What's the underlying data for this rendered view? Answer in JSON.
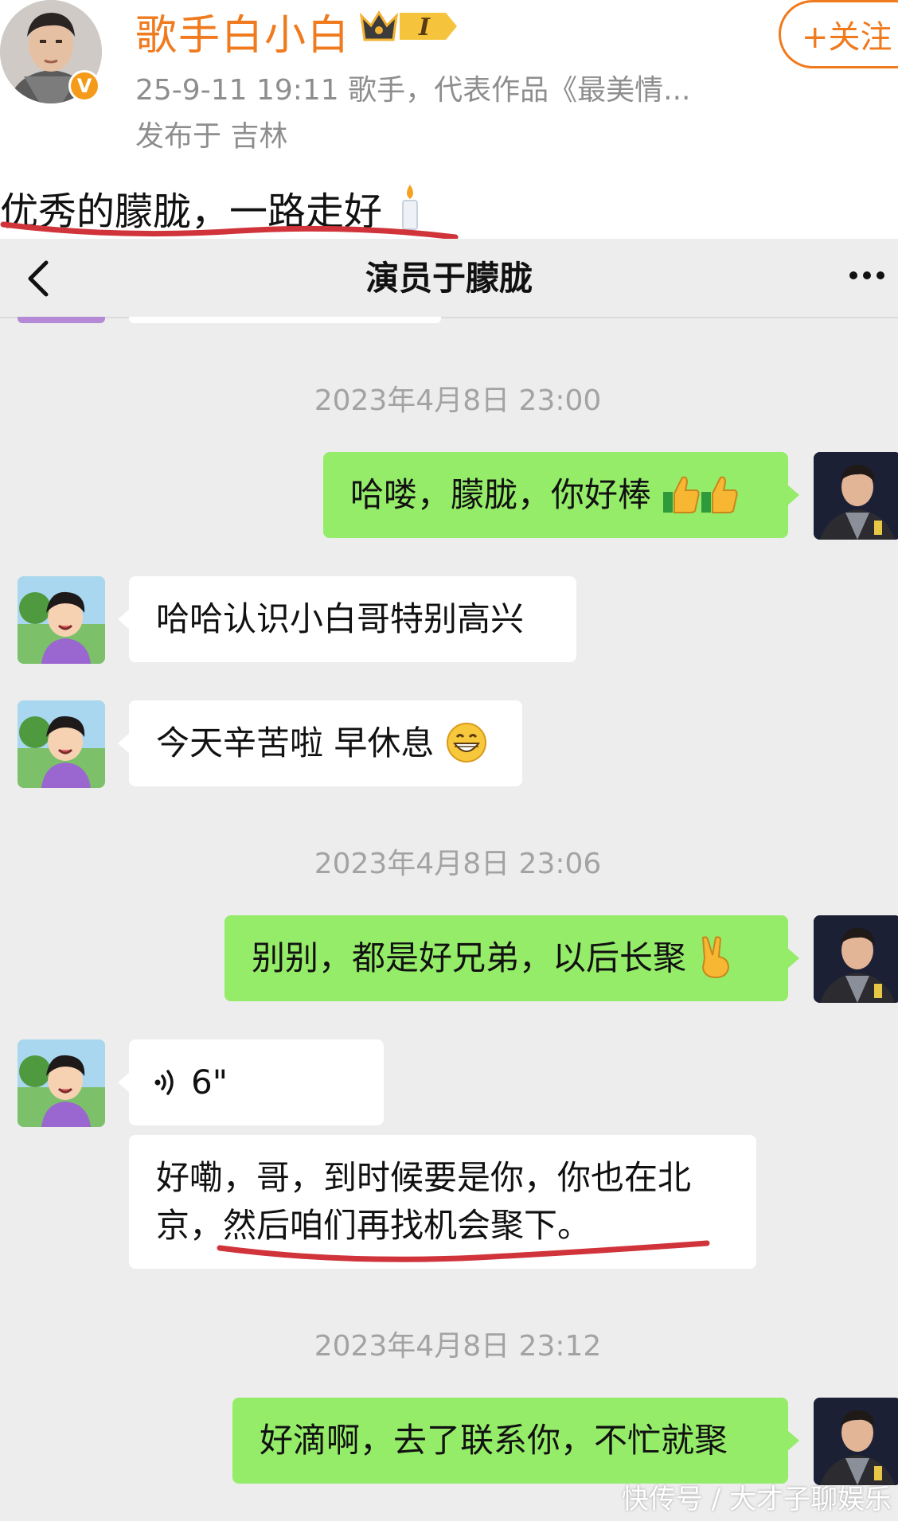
{
  "post": {
    "username": "歌手白小白",
    "verified_mark": "V",
    "rank_badge": "I",
    "follow_label": "+关注",
    "meta": "25-9-11 19:11   歌手，代表作品《最美情...",
    "location": "发布于 吉林",
    "text": "优秀的朦胧，一路走好",
    "text_emoji": "candle-icon"
  },
  "chat": {
    "title": "演员于朦胧",
    "timestamps": [
      "2023年4月8日 23:00",
      "2023年4月8日 23:06",
      "2023年4月8日 23:12"
    ],
    "messages": [
      {
        "from": "me",
        "text": "哈喽，朦胧，你好棒",
        "emoji": "thumbs-up-icon"
      },
      {
        "from": "other",
        "text": "哈哈认识小白哥特别高兴"
      },
      {
        "from": "other",
        "text": "今天辛苦啦 早休息",
        "emoji": "grin-icon"
      },
      {
        "from": "me",
        "text": "别别，都是好兄弟，以后长聚",
        "emoji": "victory-hand-icon"
      },
      {
        "from": "other",
        "type": "voice",
        "duration": "6\""
      },
      {
        "from": "other",
        "text": "好嘞，哥，到时候要是你，你也在北\n京，然后咱们再找机会聚下。"
      },
      {
        "from": "me",
        "text": "好滴啊，去了联系你，不忙就聚"
      }
    ]
  },
  "watermark": "快传号 / 大才子聊娱乐",
  "colors": {
    "accent": "#f07a1e",
    "my_bubble": "#95ec69",
    "chat_bg": "#ededed",
    "underline": "#d0343a"
  }
}
